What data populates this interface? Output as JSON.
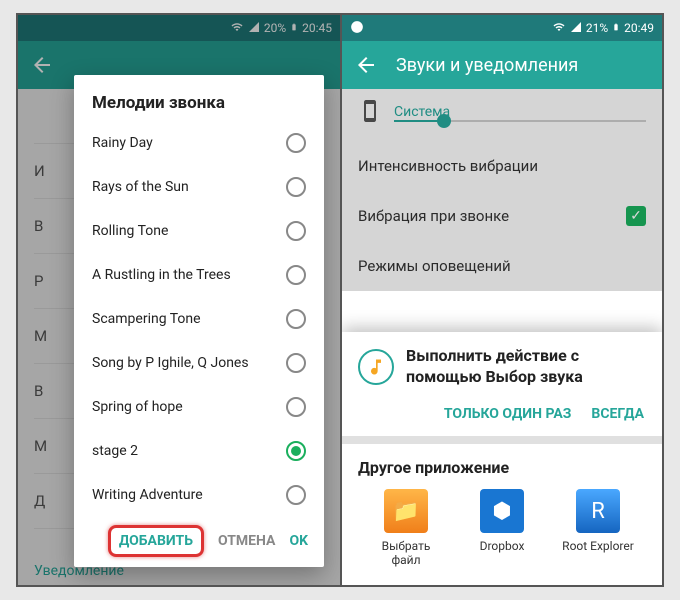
{
  "left": {
    "status": {
      "battery": "20%",
      "time": "20:45"
    },
    "bg_rows": [
      "",
      "И",
      "В",
      "Р",
      "М",
      "В",
      "М",
      "Д"
    ],
    "bg_bottom": "Уведомление",
    "dialog": {
      "title": "Мелодии звонка",
      "items": [
        {
          "label": "Rainy Day",
          "selected": false
        },
        {
          "label": "Rays of the Sun",
          "selected": false
        },
        {
          "label": "Rolling Tone",
          "selected": false
        },
        {
          "label": "A Rustling in the Trees",
          "selected": false
        },
        {
          "label": "Scampering Tone",
          "selected": false
        },
        {
          "label": "Song by P Ighile, Q Jones",
          "selected": false
        },
        {
          "label": "Spring of hope",
          "selected": false
        },
        {
          "label": "stage 2",
          "selected": true
        },
        {
          "label": "Writing Adventure",
          "selected": false
        }
      ],
      "add": "ДОБАВИТЬ",
      "cancel": "ОТМЕНА",
      "ok": "OK"
    }
  },
  "right": {
    "status": {
      "battery": "21%",
      "time": "20:49"
    },
    "appbar_title": "Звуки и уведомления",
    "system_label": "Система",
    "rows": {
      "vibration_intensity": "Интенсивность вибрации",
      "vibrate_on_call": "Вибрация при звонке",
      "notification_modes": "Режимы оповещений"
    },
    "sheet": {
      "title_line1": "Выполнить действие с",
      "title_line2": "помощью Выбор звука",
      "once": "ТОЛЬКО ОДИН РАЗ",
      "always": "ВСЕГДА",
      "other_title": "Другое приложение",
      "apps": [
        {
          "label": "Выбрать файл",
          "kind": "file"
        },
        {
          "label": "Dropbox",
          "kind": "dropbox"
        },
        {
          "label": "Root Explorer",
          "kind": "root"
        }
      ]
    }
  }
}
